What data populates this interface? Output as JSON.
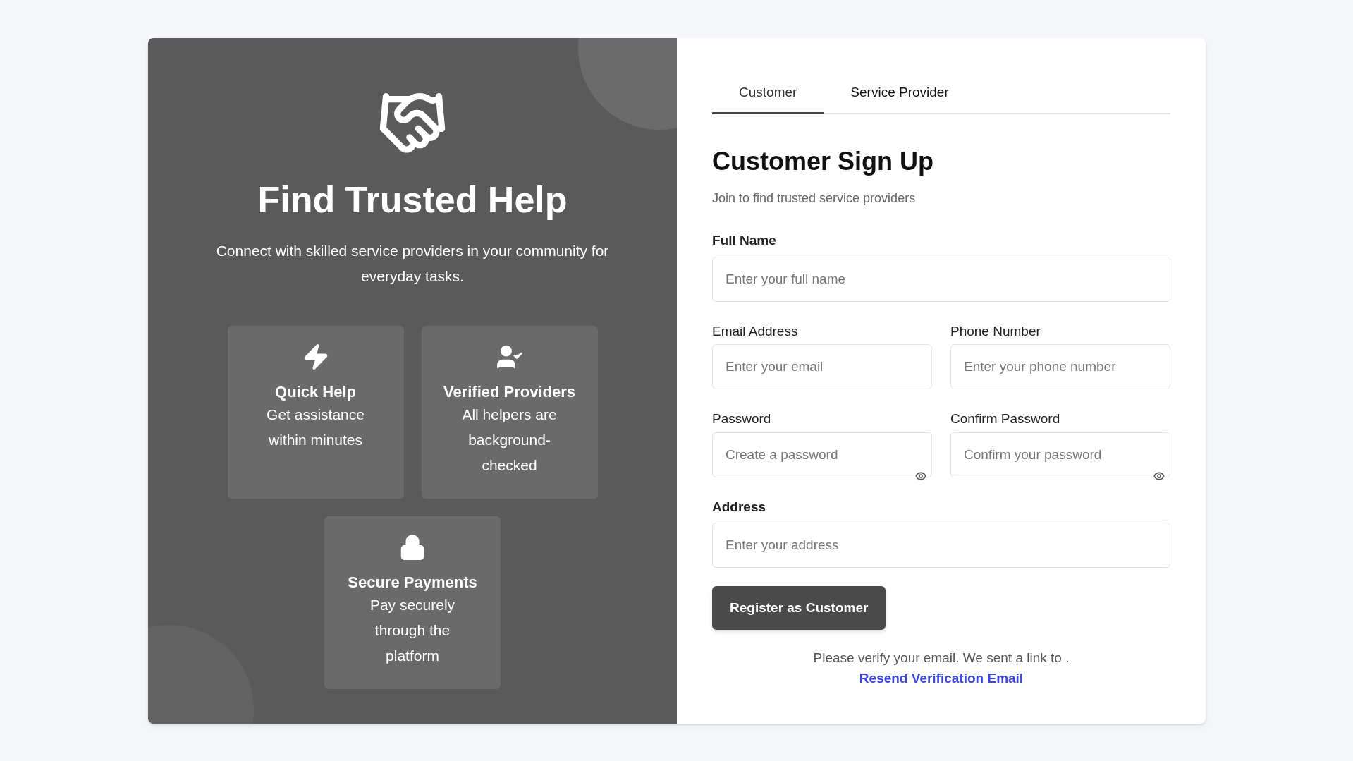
{
  "hero": {
    "title": "Find Trusted Help",
    "subtitle": "Connect with skilled service providers in your community for everyday tasks.",
    "features": [
      {
        "kind": "bolt",
        "title": "Quick Help",
        "text": "Get assistance within minutes"
      },
      {
        "kind": "user-check",
        "title": "Verified Providers",
        "text": "All helpers are background-checked"
      },
      {
        "kind": "lock",
        "title": "Secure Payments",
        "text": "Pay securely through the platform"
      }
    ]
  },
  "tabs": [
    {
      "label": "Customer",
      "selected": true
    },
    {
      "label": "Service Provider",
      "selected": false
    }
  ],
  "form": {
    "title": "Customer Sign Up",
    "subtitle": "Join to find trusted service providers",
    "rows": [
      [
        {
          "kind": "text",
          "label": "Full Name",
          "placeholder": "Enter your full name"
        }
      ],
      [
        {
          "kind": "text",
          "label": "Email Address",
          "placeholder": "Enter your email"
        },
        {
          "kind": "text",
          "label": "Phone Number",
          "placeholder": "Enter your phone number"
        }
      ],
      [
        {
          "kind": "password",
          "label": "Password",
          "placeholder": "Create a password"
        },
        {
          "kind": "password",
          "label": "Confirm Password",
          "placeholder": "Confirm your password"
        }
      ],
      [
        {
          "kind": "text",
          "label": "Address",
          "placeholder": "Enter your address"
        }
      ]
    ],
    "submit": "Register as Customer",
    "notice": "Please verify your email. We sent a link to .",
    "resend": "Resend Verification Email"
  }
}
